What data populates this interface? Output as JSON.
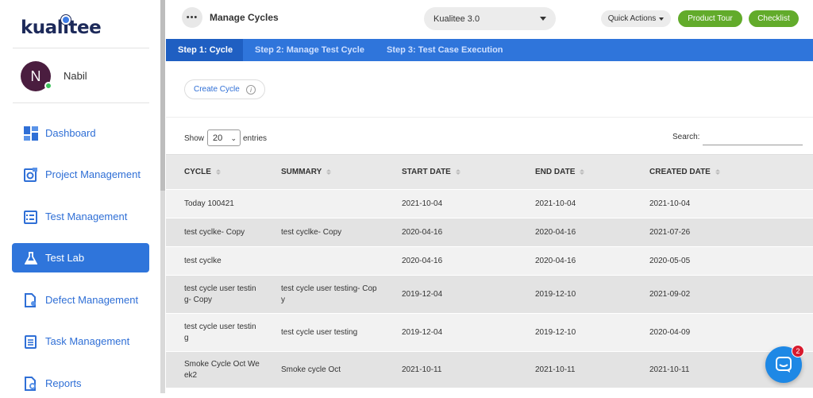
{
  "brand": {
    "logo_text_a": "kual",
    "logo_text_i": "i",
    "logo_text_b": "tee"
  },
  "user": {
    "initial": "N",
    "name": "Nabil"
  },
  "sidebar": {
    "items": [
      {
        "label": "Dashboard",
        "icon": "dashboard-icon"
      },
      {
        "label": "Project Management",
        "icon": "project-gear-icon"
      },
      {
        "label": "Test Management",
        "icon": "test-checklist-icon"
      },
      {
        "label": "Test Lab",
        "icon": "flask-icon",
        "active": true
      },
      {
        "label": "Defect Management",
        "icon": "defect-doc-icon"
      },
      {
        "label": "Task Management",
        "icon": "task-list-icon"
      },
      {
        "label": "Reports",
        "icon": "report-search-icon"
      }
    ]
  },
  "header": {
    "menu_glyph": "•••",
    "title": "Manage Cycles",
    "project": "Kualitee 3.0",
    "quick_actions": "Quick Actions",
    "product_tour": "Product Tour",
    "checklist": "Checklist"
  },
  "tabs": [
    {
      "label": "Step 1: Cycle",
      "active": true
    },
    {
      "label": "Step 2: Manage Test Cycle"
    },
    {
      "label": "Step 3: Test Case Execution"
    }
  ],
  "create_cycle": {
    "label": "Create Cycle",
    "info": "i"
  },
  "controls": {
    "show": "Show",
    "entries_value": "20",
    "entries": "entries",
    "search_label": "Search:",
    "search_value": ""
  },
  "table": {
    "columns": [
      "CYCLE",
      "SUMMARY",
      "START DATE",
      "END DATE",
      "CREATED DATE"
    ],
    "rows": [
      {
        "cycle": "Today 100421",
        "summary": "",
        "start": "2021-10-04",
        "end": "2021-10-04",
        "created": "2021-10-04"
      },
      {
        "cycle": "test cyclke- Copy",
        "summary": "test cyclke- Copy",
        "start": "2020-04-16",
        "end": "2020-04-16",
        "created": "2021-07-26"
      },
      {
        "cycle": "test cyclke",
        "summary": "",
        "start": "2020-04-16",
        "end": "2020-04-16",
        "created": "2020-05-05"
      },
      {
        "cycle": "test cycle user testin\ng- Copy",
        "summary": "test cycle user testing- Cop\ny",
        "start": "2019-12-04",
        "end": "2019-12-10",
        "created": "2021-09-02"
      },
      {
        "cycle": "test cycle user testin\ng",
        "summary": "test cycle user testing",
        "start": "2019-12-04",
        "end": "2019-12-10",
        "created": "2020-04-09"
      },
      {
        "cycle": "Smoke Cycle Oct We\nek2",
        "summary": "Smoke cycle Oct",
        "start": "2021-10-11",
        "end": "2021-10-11",
        "created": "2021-10-11"
      }
    ]
  },
  "chat": {
    "badge": "2",
    "icon": "chat-icon"
  },
  "colors": {
    "primary": "#2f75db",
    "green": "#62ab2b",
    "badge": "#d81b2e"
  }
}
